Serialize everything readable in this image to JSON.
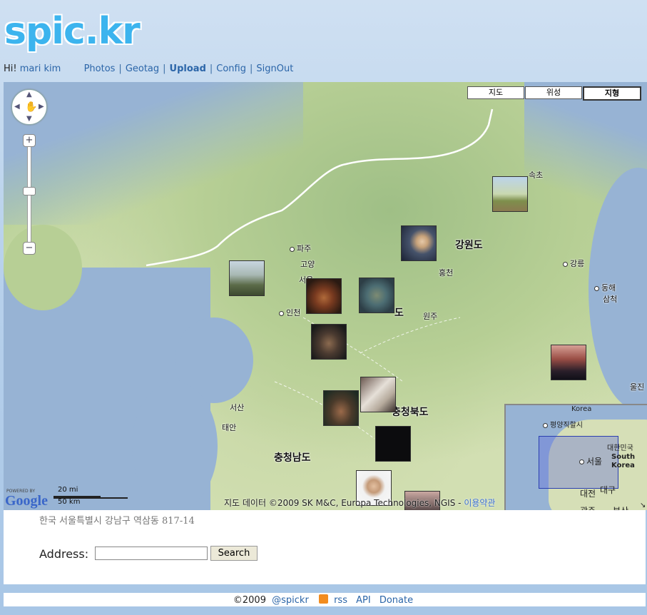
{
  "brand": {
    "logo": "spic.kr"
  },
  "topnav": {
    "greeting": "Hi!",
    "user": "mari kim",
    "links": [
      "Photos",
      "Geotag",
      "Upload",
      "Config",
      "SignOut"
    ],
    "separator": "|"
  },
  "map": {
    "types": [
      "지도",
      "위성",
      "지형"
    ],
    "active_type": "지형",
    "places": [
      {
        "name": "속초"
      },
      {
        "name": "강원도"
      },
      {
        "name": "파주"
      },
      {
        "name": "고양"
      },
      {
        "name": "서울"
      },
      {
        "name": "홍천"
      },
      {
        "name": "강릉"
      },
      {
        "name": "동해"
      },
      {
        "name": "삼척"
      },
      {
        "name": "인천"
      },
      {
        "name": "원주"
      },
      {
        "name": "도"
      },
      {
        "name": "충청북도"
      },
      {
        "name": "서산"
      },
      {
        "name": "태안"
      },
      {
        "name": "충청남도"
      },
      {
        "name": "울진"
      }
    ],
    "overview": [
      "Korea",
      "평양직할시",
      "대한민국",
      "South",
      "Korea",
      "서울",
      "대전",
      "대구",
      "광주",
      "부산"
    ],
    "powered_by": "POWERED BY",
    "google": "Google",
    "scale": {
      "miles": "20 mi",
      "km": "50 km"
    },
    "attribution": "지도 데이터 ©2009 SK M&C, Europa Technologies, NGIS -",
    "terms": "이용약관"
  },
  "address_panel": {
    "current_address": "한국 서울특별시 강남구 역삼동 817-14",
    "label": "Address:",
    "input_value": "",
    "button": "Search"
  },
  "footer": {
    "copyright": "©2009",
    "links": [
      "@spickr",
      "rss",
      "API",
      "Donate"
    ]
  },
  "colors": {
    "logo": "#3cb4ee",
    "link": "#2b65a8",
    "sea": "#97b3d4",
    "land": "#c3d7a0"
  }
}
